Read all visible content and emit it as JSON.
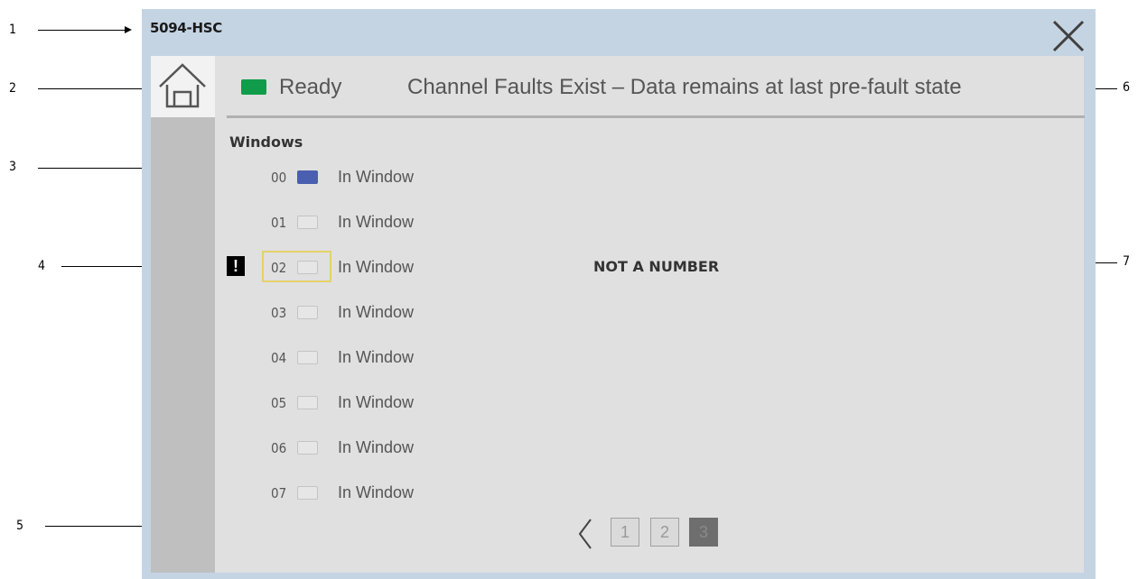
{
  "callouts": [
    "1",
    "2",
    "3",
    "4",
    "5",
    "6",
    "7"
  ],
  "window": {
    "title": "5094-HSC",
    "close_icon": "close-icon"
  },
  "home": {
    "icon": "home-icon"
  },
  "status": {
    "led_color": "#109c4a",
    "text": "Ready",
    "fault_message": "Channel Faults Exist – Data remains at last pre-fault state"
  },
  "windows": {
    "title": "Windows",
    "items": [
      {
        "num": "00",
        "label": "In Window",
        "active": true
      },
      {
        "num": "01",
        "label": "In Window",
        "active": false
      },
      {
        "num": "02",
        "label": "In Window",
        "active": false
      },
      {
        "num": "03",
        "label": "In Window",
        "active": false
      },
      {
        "num": "04",
        "label": "In Window",
        "active": false
      },
      {
        "num": "05",
        "label": "In Window",
        "active": false
      },
      {
        "num": "06",
        "label": "In Window",
        "active": false
      },
      {
        "num": "07",
        "label": "In Window",
        "active": false
      }
    ],
    "warning_icon_text": "!",
    "value_text": "NOT A NUMBER"
  },
  "pagination": {
    "pages": [
      "1",
      "2",
      "3"
    ],
    "current": "3",
    "prev_icon": "chevron-left-icon"
  },
  "colors": {
    "panel_bg": "#c5d4e3",
    "content_bg": "#e0e0e0",
    "active_box": "#4a5fb0",
    "warning_frame": "#e6d16b"
  }
}
